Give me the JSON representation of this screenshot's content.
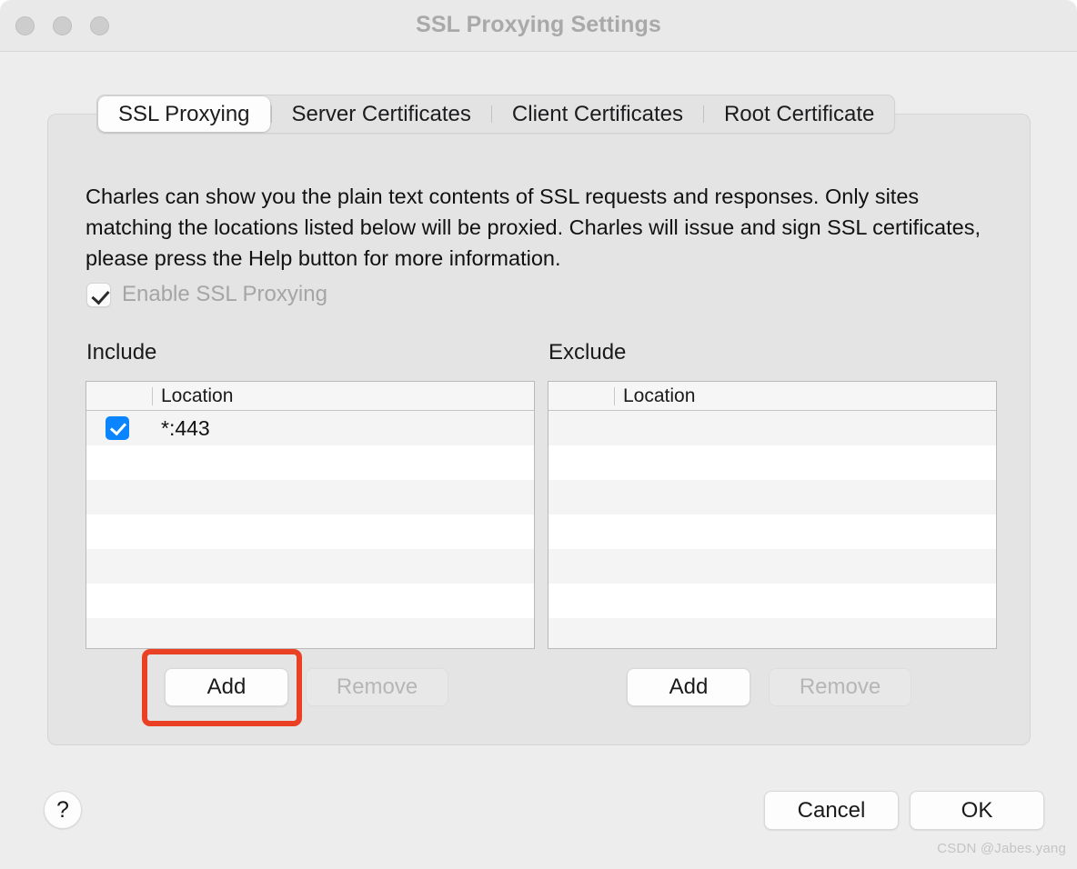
{
  "window": {
    "title": "SSL Proxying Settings",
    "traffic_lights": [
      "close",
      "minimize",
      "maximize"
    ]
  },
  "tabs": [
    {
      "label": "SSL Proxying",
      "active": true
    },
    {
      "label": "Server Certificates",
      "active": false
    },
    {
      "label": "Client Certificates",
      "active": false
    },
    {
      "label": "Root Certificate",
      "active": false
    }
  ],
  "panel": {
    "description": "Charles can show you the plain text contents of SSL requests and responses. Only sites matching the locations listed below will be proxied. Charles will issue and sign SSL certificates, please press the Help button for more information.",
    "enable_checkbox": {
      "label": "Enable SSL Proxying",
      "checked": true,
      "enabled": false
    },
    "include": {
      "title": "Include",
      "column_header": "Location",
      "rows": [
        {
          "checked": true,
          "location": "*:443"
        }
      ],
      "empty_row_count": 6,
      "add_label": "Add",
      "remove_label": "Remove",
      "remove_enabled": false
    },
    "exclude": {
      "title": "Exclude",
      "column_header": "Location",
      "rows": [],
      "empty_row_count": 7,
      "add_label": "Add",
      "remove_label": "Remove",
      "remove_enabled": false
    }
  },
  "footer": {
    "help_label": "?",
    "cancel_label": "Cancel",
    "ok_label": "OK"
  },
  "watermark": "CSDN @Jabes.yang",
  "colors": {
    "accent_blue": "#0a84ff",
    "highlight_red": "#ea4125",
    "window_bg": "#ededed",
    "panel_bg": "#e4e4e4"
  }
}
